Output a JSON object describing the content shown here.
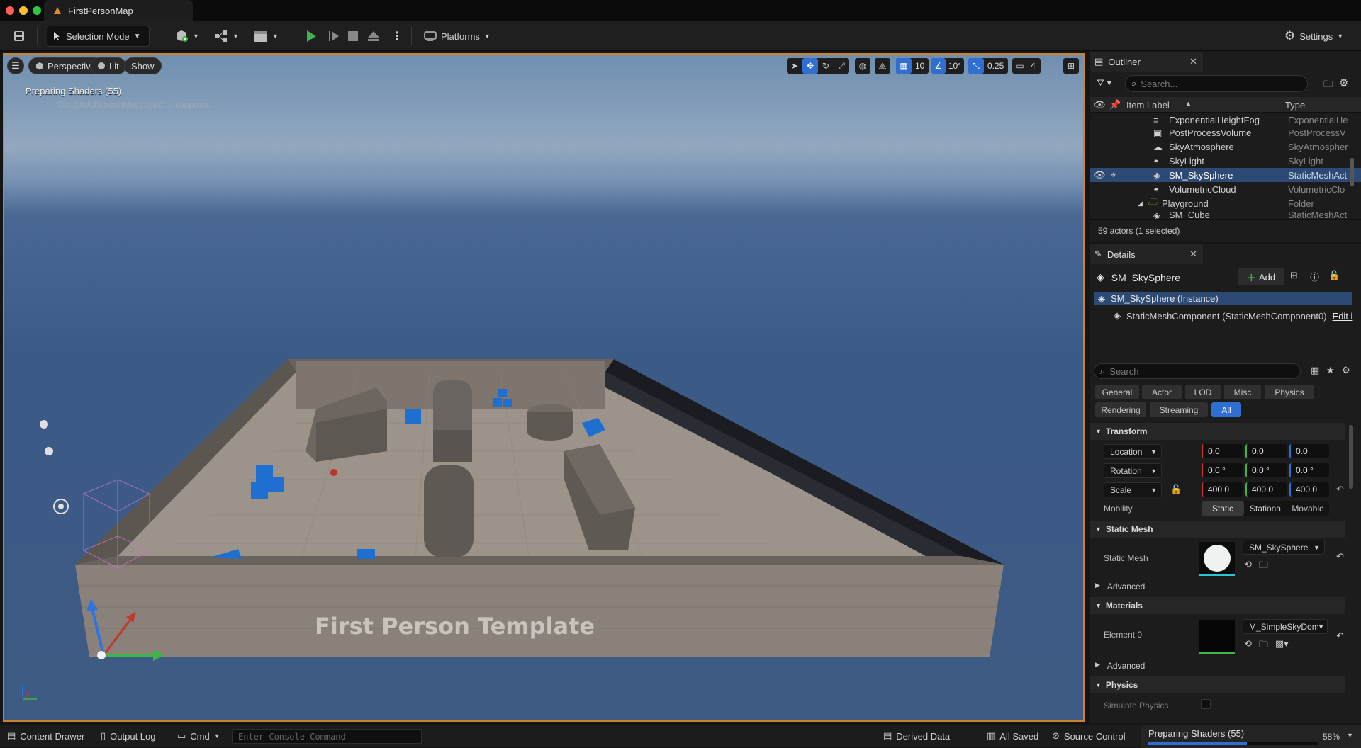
{
  "window": {
    "title": "FirstPersonMap"
  },
  "toolbar": {
    "selection_mode": "Selection Mode",
    "platforms": "Platforms",
    "settings": "Settings"
  },
  "viewport": {
    "perspective": "Perspective",
    "lit": "Lit",
    "show": "Show",
    "grid_snap": "10",
    "rotation_snap": "10°",
    "scale_snap": "0.25",
    "camera_speed": "4",
    "message": "Preparing Shaders (55)",
    "message_hint": "'DisableAllScreenMessages' to suppress",
    "floor_text": "First Person Template"
  },
  "outliner": {
    "tab": "Outliner",
    "search_placeholder": "Search...",
    "col_label": "Item Label",
    "col_type": "Type",
    "rows": [
      {
        "label": "ExponentialHeightFog",
        "type": "ExponentialHe"
      },
      {
        "label": "PostProcessVolume",
        "type": "PostProcessV"
      },
      {
        "label": "SkyAtmosphere",
        "type": "SkyAtmospher"
      },
      {
        "label": "SkyLight",
        "type": "SkyLight"
      },
      {
        "label": "SM_SkySphere",
        "type": "StaticMeshAct"
      },
      {
        "label": "VolumetricCloud",
        "type": "VolumetricClo"
      },
      {
        "label": "Playground",
        "type": "Folder"
      },
      {
        "label": "SM_Cube",
        "type": "StaticMeshAct"
      }
    ],
    "footer": "59 actors (1 selected)"
  },
  "details": {
    "tab": "Details",
    "actor_name": "SM_SkySphere",
    "add_label": "Add",
    "instance": "SM_SkySphere (Instance)",
    "component": "StaticMeshComponent (StaticMeshComponent0)",
    "edit_link": "Edit i",
    "search_placeholder": "Search",
    "categories": [
      "General",
      "Actor",
      "LOD",
      "Misc",
      "Physics",
      "Rendering",
      "Streaming",
      "All"
    ],
    "transform": {
      "header": "Transform",
      "location_label": "Location",
      "location": [
        "0.0",
        "0.0",
        "0.0"
      ],
      "rotation_label": "Rotation",
      "rotation": [
        "0.0 °",
        "0.0 °",
        "0.0 °"
      ],
      "scale_label": "Scale",
      "scale": [
        "400.0",
        "400.0",
        "400.0"
      ],
      "mobility_label": "Mobility",
      "mobility": [
        "Static",
        "Stationa",
        "Movable"
      ]
    },
    "static_mesh": {
      "header": "Static Mesh",
      "label": "Static Mesh",
      "value": "SM_SkySphere",
      "advanced": "Advanced"
    },
    "materials": {
      "header": "Materials",
      "label": "Element 0",
      "value": "M_SimpleSkyDome",
      "advanced": "Advanced"
    },
    "physics": {
      "header": "Physics",
      "simulate": "Simulate Physics"
    }
  },
  "status": {
    "content_drawer": "Content Drawer",
    "output_log": "Output Log",
    "cmd": "Cmd",
    "console_placeholder": "Enter Console Command",
    "derived_data": "Derived Data",
    "all_saved": "All Saved",
    "source_control": "Source Control",
    "progress_label": "Preparing Shaders (55)",
    "progress_value": 0.58,
    "progress_pct": "58%"
  },
  "colors": {
    "accent": "#2f6fd1",
    "viewport_border": "#c9852b",
    "play": "#3fb44a"
  }
}
